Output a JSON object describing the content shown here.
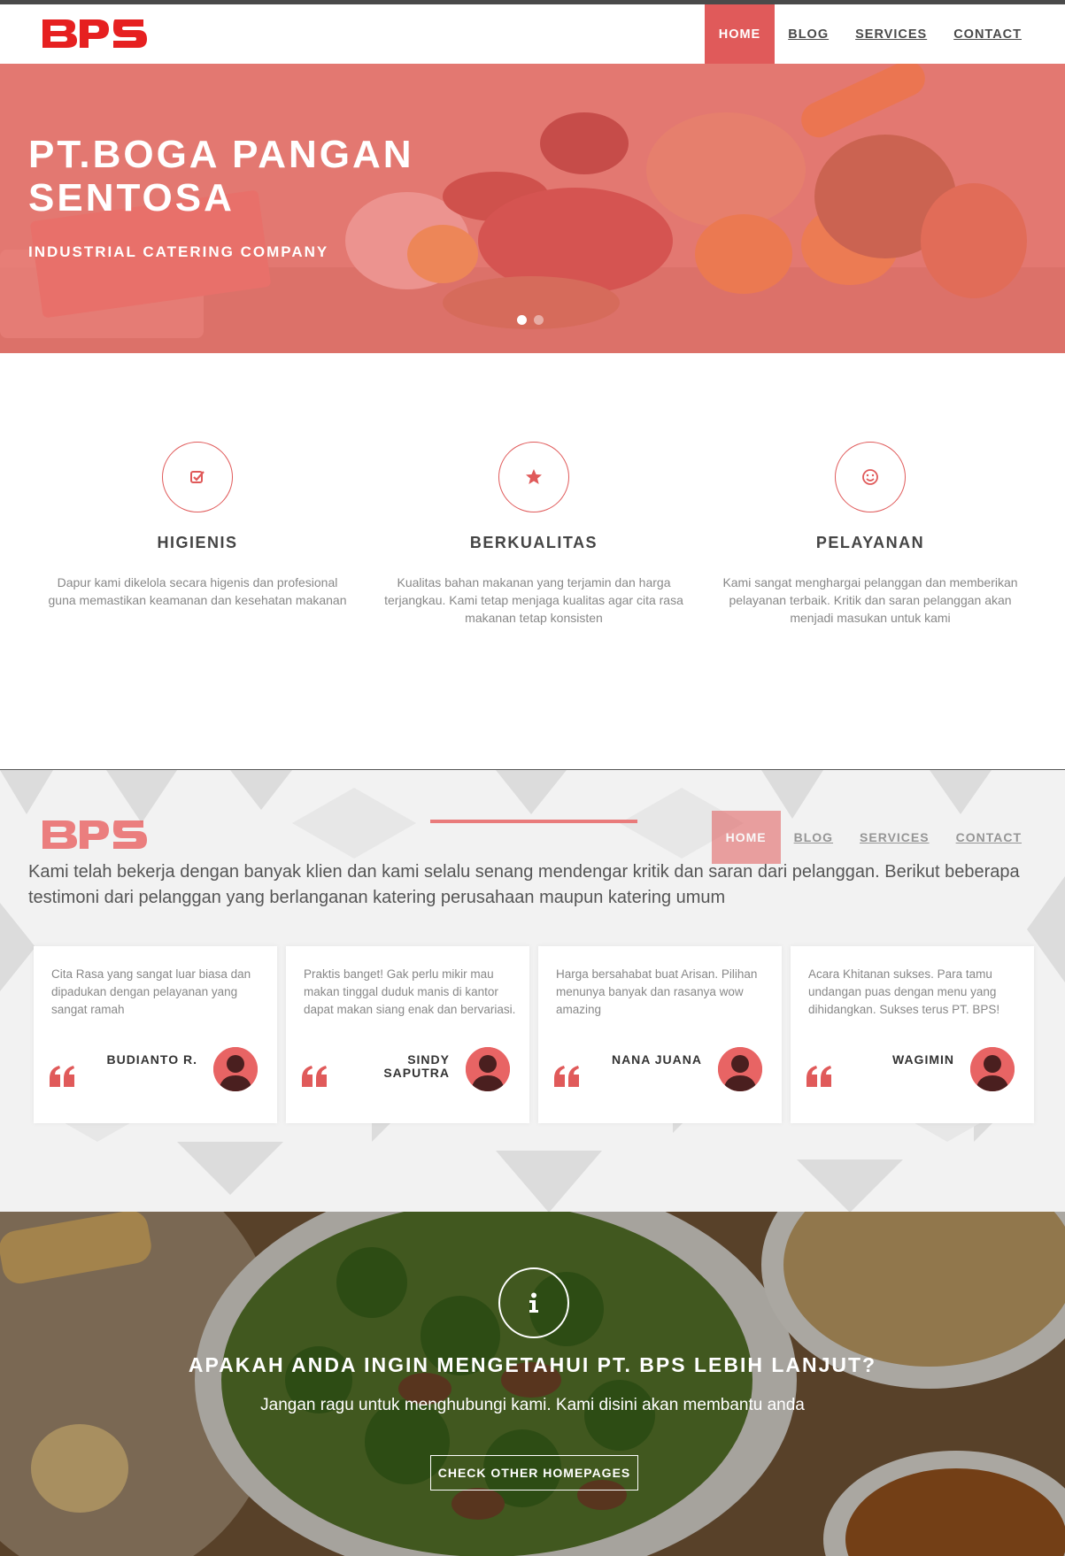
{
  "brand": {
    "logo_text": "BPS",
    "accent_color": "#e05a5a",
    "dark_color": "#4a4a4a"
  },
  "nav": {
    "items": [
      {
        "label": "HOME",
        "active": true
      },
      {
        "label": "BLOG",
        "active": false
      },
      {
        "label": "SERVICES",
        "active": false
      },
      {
        "label": "CONTACT",
        "active": false
      }
    ]
  },
  "hero": {
    "title": "PT.BOGA PANGAN SENTOSA",
    "subtitle": "INDUSTRIAL CATERING COMPANY",
    "slides_total": 2,
    "active_slide": 1
  },
  "features": [
    {
      "icon": "check-square-icon",
      "title": "HIGIENIS",
      "text": "Dapur kami dikelola secara higenis dan profesional guna memastikan keamanan dan kesehatan makanan"
    },
    {
      "icon": "star-icon",
      "title": "BERKUALITAS",
      "text": "Kualitas bahan makanan yang terjamin dan harga terjangkau. Kami tetap menjaga kualitas agar cita rasa makanan tetap konsisten"
    },
    {
      "icon": "smile-icon",
      "title": "PELAYANAN",
      "text": "Kami sangat menghargai pelanggan dan memberikan pelayanan terbaik. Kritik dan saran pelanggan akan menjadi masukan untuk kami"
    }
  ],
  "testimonials": {
    "intro": "Kami telah bekerja dengan banyak klien dan kami selalu senang mendengar kritik dan saran dari pelanggan. Berikut beberapa testimoni dari pelanggan yang berlanganan katering perusahaan maupun katering umum",
    "items": [
      {
        "text": "Cita Rasa yang sangat luar biasa dan dipadukan dengan pelayanan yang sangat ramah",
        "name": "BUDIANTO R."
      },
      {
        "text": "Praktis banget! Gak perlu mikir mau makan tinggal duduk manis di kantor dapat makan siang enak dan bervariasi.",
        "name": "SINDY SAPUTRA"
      },
      {
        "text": "Harga bersahabat buat Arisan. Pilihan menunya banyak dan rasanya wow amazing",
        "name": "NANA JUANA"
      },
      {
        "text": "Acara Khitanan sukses. Para tamu undangan puas dengan menu yang dihidangkan. Sukses terus PT. BPS!",
        "name": "WAGIMIN"
      }
    ]
  },
  "cta": {
    "icon": "info-icon",
    "title": "APAKAH ANDA INGIN MENGETAHUI PT. BPS LEBIH LANJUT?",
    "subtitle": "Jangan ragu untuk menghubungi kami. Kami disini akan membantu anda",
    "button_label": "CHECK OTHER HOMEPAGES"
  }
}
